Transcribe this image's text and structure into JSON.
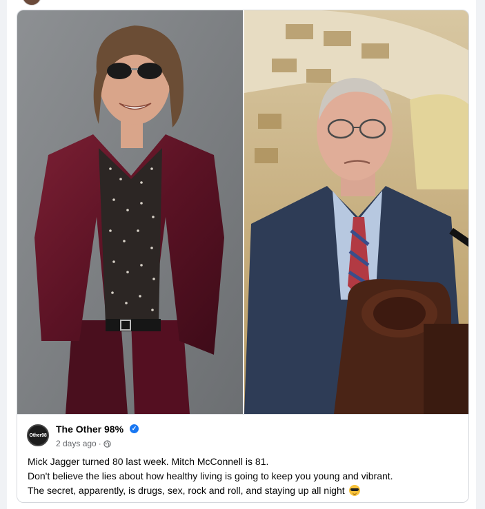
{
  "page": {
    "name": "The Other 98%",
    "avatar_text": "Other98",
    "timestamp": "2 days ago",
    "separator": "·",
    "verified_icon": "verified-badge-icon",
    "audience_icon": "globe-icon"
  },
  "post": {
    "lines": [
      "Mick Jagger turned 80 last week. Mitch McConnell is 81.",
      "Don't believe the lies about how healthy living is going to keep you young and vibrant.",
      "The secret, apparently, is drugs, sex, rock and roll, and staying up all night"
    ],
    "emoji": "smiling-face-with-sunglasses-icon"
  },
  "colors": {
    "verified": "#1877f2",
    "text": "#050505",
    "meta": "#65676b"
  }
}
